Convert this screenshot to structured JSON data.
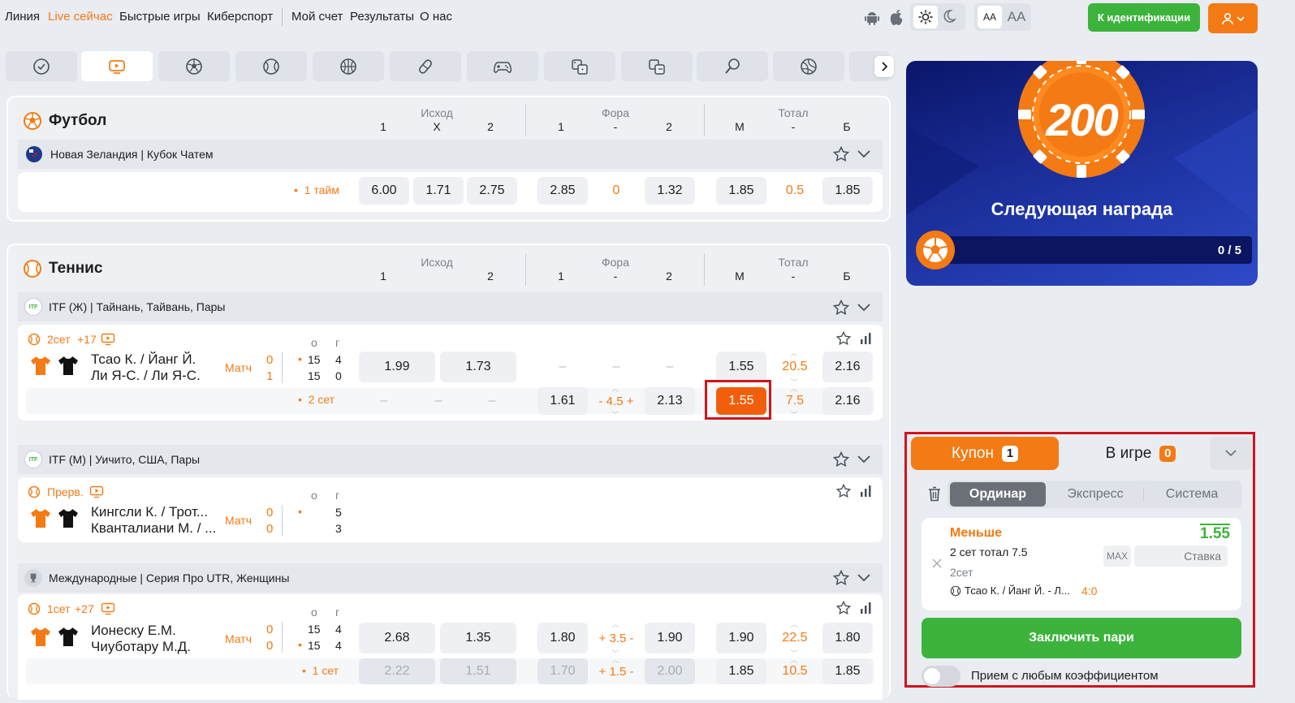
{
  "header": {
    "nav": [
      "Линия",
      "Live сейчас",
      "Быстрые игры",
      "Киберспорт"
    ],
    "nav2": [
      "Мой счет",
      "Результаты",
      "О нас"
    ],
    "font_small": "AA",
    "font_big": "AA",
    "ident_button": "К идентификации"
  },
  "sport_tabs": [
    "check-icon",
    "live-tv-icon",
    "football-icon",
    "tennis-icon",
    "basketball-icon",
    "table-tennis-icon",
    "esports-icon",
    "dice-icon",
    "fast-games-icon",
    "badminton-icon",
    "volleyball-icon"
  ],
  "football": {
    "title": "Футбол",
    "groups": {
      "outcome": "Исход",
      "handicap": "Фора",
      "total": "Тотал"
    },
    "cols": {
      "c1": "1",
      "cx": "X",
      "c2": "2",
      "h1": "1",
      "hmid": "-",
      "h2": "2",
      "tm": "М",
      "tmid": "-",
      "tb": "Б"
    },
    "league": "Новая Зеландия | Кубок Чатем",
    "row": {
      "period": "1 тайм",
      "o1": "6.00",
      "ox": "1.71",
      "o2": "2.75",
      "h1": "2.85",
      "hv": "0",
      "h2": "1.32",
      "tm": "1.85",
      "tv": "0.5",
      "tb": "1.85"
    }
  },
  "tennis": {
    "title": "Теннис",
    "groups": {
      "outcome": "Исход",
      "handicap": "Фора",
      "total": "Тотал"
    },
    "cols": {
      "c1": "1",
      "c2": "2",
      "h1": "1",
      "hmid": "-",
      "h2": "2",
      "tm": "М",
      "tmid": "-",
      "tb": "Б"
    },
    "matches": [
      {
        "league": "ITF (Ж) | Тайнань, Тайвань, Пары",
        "status": "2сет",
        "extra": "+17",
        "team1": "Тсао К. / Йанг Й.",
        "team2": "Ли Я-С. / Ли Я-С.",
        "type": "Матч",
        "s1": "0",
        "s2": "1",
        "head_o": "о",
        "head_g": "г",
        "g1": "15",
        "p1": "4",
        "g2": "15",
        "p2": "0",
        "main": {
          "o1": "1.99",
          "o2": "1.73",
          "h1": "–",
          "hv": "–",
          "h2": "–",
          "tm": "1.55",
          "tv": "20.5",
          "tb": "2.16"
        },
        "sub": {
          "period": "2 сет",
          "o1": "–",
          "ox": "–",
          "o2": "–",
          "h1": "1.61",
          "hv": "- 4.5 +",
          "h2": "2.13",
          "tm": "1.55",
          "tv": "7.5",
          "tb": "2.16"
        }
      },
      {
        "league": "ITF (М) | Уичито, США, Пары",
        "status": "Прерв.",
        "team1": "Кингсли К. / Трот...",
        "team2": "Кванталиани М. / ...",
        "type": "Матч",
        "s1": "0",
        "s2": "0",
        "head_o": "о",
        "head_g": "г",
        "p1": "5",
        "p2": "3"
      },
      {
        "league": "Международные | Серия Про UTR, Женщины",
        "status": "1сет",
        "extra": "+27",
        "team1": "Ионеску Е.М.",
        "team2": "Чиуботару М.Д.",
        "type": "Матч",
        "s1": "0",
        "s2": "0",
        "head_o": "о",
        "head_g": "г",
        "g1": "15",
        "p1": "4",
        "g2": "15",
        "p2": "4",
        "main": {
          "o1": "2.68",
          "o2": "1.35",
          "h1": "1.80",
          "hv": "+ 3.5 -",
          "h2": "1.90",
          "tm": "1.90",
          "tv": "22.5",
          "tb": "1.80"
        },
        "sub": {
          "period": "1 сет",
          "o1": "2.22",
          "o2": "1.51",
          "h1": "1.70",
          "hv": "+ 1.5 -",
          "h2": "2.00",
          "tm": "1.85",
          "tv": "10.5",
          "tb": "1.85"
        }
      }
    ]
  },
  "reward": {
    "chip": "200",
    "title": "Следующая награда",
    "progress_text": "0 / 5",
    "progress": 0
  },
  "coupon": {
    "tab_coupon": "Купон",
    "coupon_count": "1",
    "tab_ingame": "В игре",
    "ingame_count": "0",
    "modes": [
      "Ординар",
      "Экспресс",
      "Система"
    ],
    "bet": {
      "selection": "Меньше",
      "odds": "1.55",
      "market": "2 сет тотал 7.5",
      "period": "2сет",
      "event": "Тсао К. / Йанг Й. - Л...",
      "score": "4:0",
      "max": "MAX",
      "stake_placeholder": "Ставка"
    },
    "place_button": "Заключить пари",
    "accept_any": "Прием с любым коэффициентом"
  },
  "colors": {
    "accent": "#f47a14",
    "selected": "#f25f0c",
    "green": "#3cb43c",
    "highlight": "#d0141c"
  }
}
